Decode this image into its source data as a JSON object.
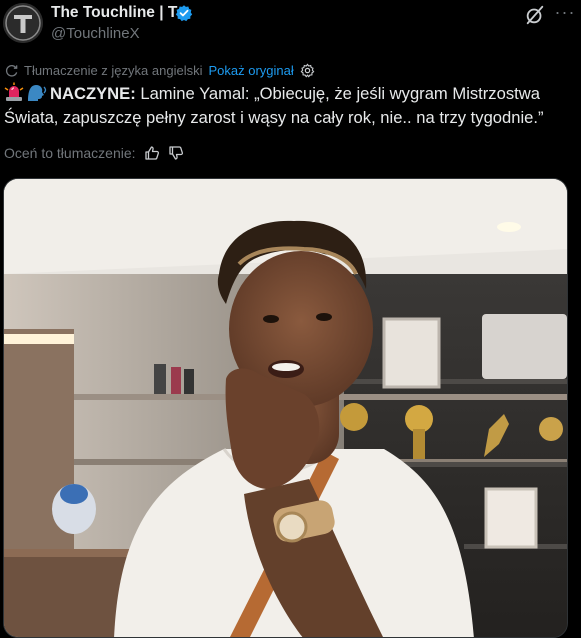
{
  "account": {
    "display_name": "The Touchline | T",
    "handle": "@TouchlineX",
    "verified": true,
    "avatar_icon": "touchline-logo-avatar"
  },
  "header_actions": {
    "grok_icon": "grok-icon",
    "more_label": "···"
  },
  "translation": {
    "label": "Tłumaczenie z języka angielski",
    "show_original": "Pokaż oryginał"
  },
  "tweet": {
    "emojis": [
      "police-light-emoji",
      "speaking-head-emoji"
    ],
    "prefix": "NACZYNE:",
    "line1": " Lamine Yamal: „Obiecuję, że jeśli wygram Mistrzostwa",
    "line2": "Świata, zapuszczę pełny zarost i wąsy na cały rok, nie.. na trzy tygodnie.”"
  },
  "rate": {
    "label": "Oceń to tłumaczenie:"
  },
  "media": {
    "type": "video-still",
    "description_icon": "video-thumbnail"
  },
  "colors": {
    "background": "#000000",
    "text": "#e7e9ea",
    "secondary": "#71767b",
    "link": "#1d9bf0"
  }
}
